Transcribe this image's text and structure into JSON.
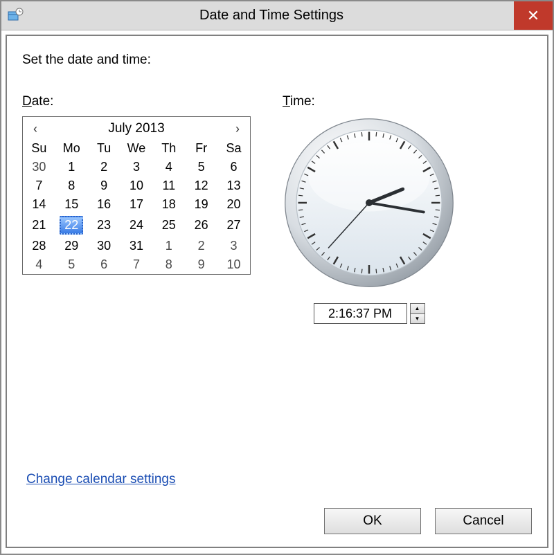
{
  "window": {
    "title": "Date and Time Settings",
    "close_icon": "✕"
  },
  "instruction": "Set the date and time:",
  "labels": {
    "date_initial": "D",
    "date_rest": "ate:",
    "time_initial": "T",
    "time_rest": "ime:"
  },
  "calendar": {
    "month_label": "July 2013",
    "prev": "‹",
    "next": "›",
    "weekdays": [
      "Su",
      "Mo",
      "Tu",
      "We",
      "Th",
      "Fr",
      "Sa"
    ],
    "weeks": [
      [
        {
          "d": "30",
          "dim": true
        },
        {
          "d": "1"
        },
        {
          "d": "2"
        },
        {
          "d": "3"
        },
        {
          "d": "4"
        },
        {
          "d": "5"
        },
        {
          "d": "6"
        }
      ],
      [
        {
          "d": "7"
        },
        {
          "d": "8"
        },
        {
          "d": "9"
        },
        {
          "d": "10"
        },
        {
          "d": "11"
        },
        {
          "d": "12"
        },
        {
          "d": "13"
        }
      ],
      [
        {
          "d": "14"
        },
        {
          "d": "15"
        },
        {
          "d": "16"
        },
        {
          "d": "17"
        },
        {
          "d": "18"
        },
        {
          "d": "19"
        },
        {
          "d": "20"
        }
      ],
      [
        {
          "d": "21"
        },
        {
          "d": "22",
          "selected": true
        },
        {
          "d": "23"
        },
        {
          "d": "24"
        },
        {
          "d": "25"
        },
        {
          "d": "26"
        },
        {
          "d": "27"
        }
      ],
      [
        {
          "d": "28"
        },
        {
          "d": "29"
        },
        {
          "d": "30"
        },
        {
          "d": "31"
        },
        {
          "d": "1",
          "dim": true
        },
        {
          "d": "2",
          "dim": true
        },
        {
          "d": "3",
          "dim": true
        }
      ],
      [
        {
          "d": "4",
          "dim": true
        },
        {
          "d": "5",
          "dim": true
        },
        {
          "d": "6",
          "dim": true
        },
        {
          "d": "7",
          "dim": true
        },
        {
          "d": "8",
          "dim": true
        },
        {
          "d": "9",
          "dim": true
        },
        {
          "d": "10",
          "dim": true
        }
      ]
    ]
  },
  "time": {
    "value": "2:16:37 PM",
    "spin_up": "▲",
    "spin_down": "▼",
    "hour": 2,
    "minute": 16,
    "second": 37
  },
  "link": {
    "change_calendar": "Change calendar settings"
  },
  "buttons": {
    "ok": "OK",
    "cancel": "Cancel"
  }
}
